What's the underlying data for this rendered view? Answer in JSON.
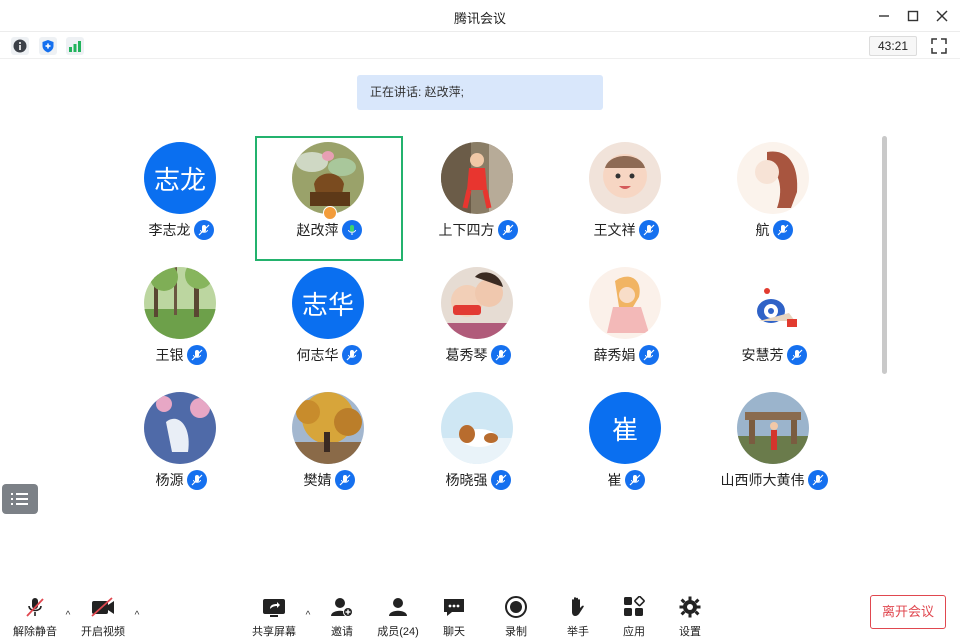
{
  "window": {
    "title": "腾讯会议"
  },
  "top_toolbar": {
    "timer": "43:21"
  },
  "speaking": {
    "label": "正在讲话: 赵改萍;"
  },
  "participants": [
    {
      "name": "李志龙",
      "avatar_text": "志龙"
    },
    {
      "name": "赵改萍",
      "avatar_text": ""
    },
    {
      "name": "上下四方",
      "avatar_text": ""
    },
    {
      "name": "王文祥",
      "avatar_text": ""
    },
    {
      "name": "航",
      "avatar_text": ""
    },
    {
      "name": "王银",
      "avatar_text": ""
    },
    {
      "name": "何志华",
      "avatar_text": "志华"
    },
    {
      "name": "葛秀琴",
      "avatar_text": ""
    },
    {
      "name": "薛秀娟",
      "avatar_text": ""
    },
    {
      "name": "安慧芳",
      "avatar_text": ""
    },
    {
      "name": "杨源",
      "avatar_text": ""
    },
    {
      "name": "樊婧",
      "avatar_text": ""
    },
    {
      "name": "杨晓强",
      "avatar_text": ""
    },
    {
      "name": "崔",
      "avatar_text": "崔"
    },
    {
      "name": "山西师大黄伟",
      "avatar_text": ""
    }
  ],
  "bottom_bar": {
    "unmute": "解除静音",
    "start_video": "开启视频",
    "share_screen": "共享屏幕",
    "invite": "邀请",
    "members": "成员(24)",
    "chat": "聊天",
    "record": "录制",
    "raise_hand": "举手",
    "apps": "应用",
    "settings": "设置",
    "leave": "离开会议"
  },
  "colors": {
    "accent": "#1570ef",
    "active_border": "#23b26d",
    "leave": "#e0474f"
  }
}
